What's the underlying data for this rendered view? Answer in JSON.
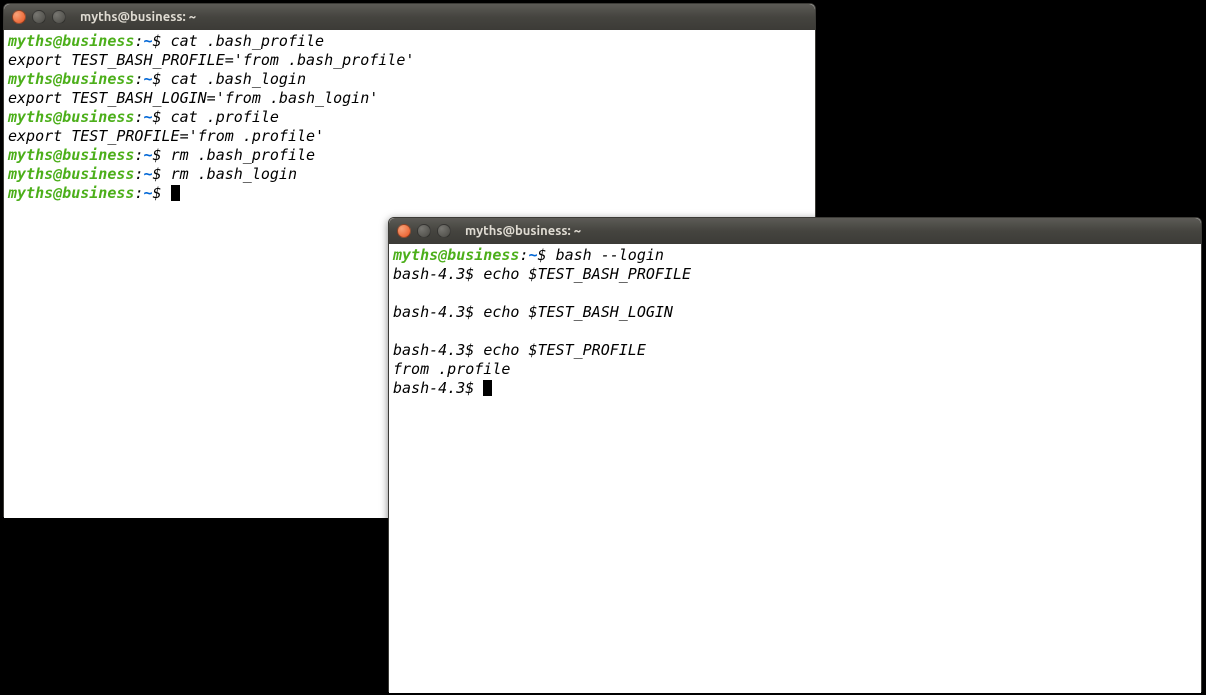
{
  "window1": {
    "title": "myths@business: ~",
    "prompt_user": "myths@business",
    "prompt_sep": ":",
    "prompt_path": "~",
    "prompt_symbol": "$",
    "lines": [
      {
        "type": "prompt_cmd",
        "cmd": "cat .bash_profile"
      },
      {
        "type": "output",
        "text": "export TEST_BASH_PROFILE='from .bash_profile'"
      },
      {
        "type": "prompt_cmd",
        "cmd": "cat .bash_login"
      },
      {
        "type": "output",
        "text": "export TEST_BASH_LOGIN='from .bash_login'"
      },
      {
        "type": "prompt_cmd",
        "cmd": "cat .profile"
      },
      {
        "type": "output",
        "text": "export TEST_PROFILE='from .profile'"
      },
      {
        "type": "prompt_cmd",
        "cmd": "rm .bash_profile"
      },
      {
        "type": "prompt_cmd",
        "cmd": "rm .bash_login"
      },
      {
        "type": "prompt_cursor"
      }
    ]
  },
  "window2": {
    "title": "myths@business: ~",
    "prompt_user": "myths@business",
    "prompt_sep": ":",
    "prompt_path": "~",
    "prompt_symbol": "$",
    "bash_prompt": "bash-4.3$",
    "lines": [
      {
        "type": "prompt_cmd",
        "cmd": "bash --login"
      },
      {
        "type": "bash_cmd",
        "cmd": "echo $TEST_BASH_PROFILE"
      },
      {
        "type": "output",
        "text": ""
      },
      {
        "type": "bash_cmd",
        "cmd": "echo $TEST_BASH_LOGIN"
      },
      {
        "type": "output",
        "text": ""
      },
      {
        "type": "bash_cmd",
        "cmd": "echo $TEST_PROFILE"
      },
      {
        "type": "output",
        "text": "from .profile"
      },
      {
        "type": "bash_cursor"
      }
    ]
  }
}
